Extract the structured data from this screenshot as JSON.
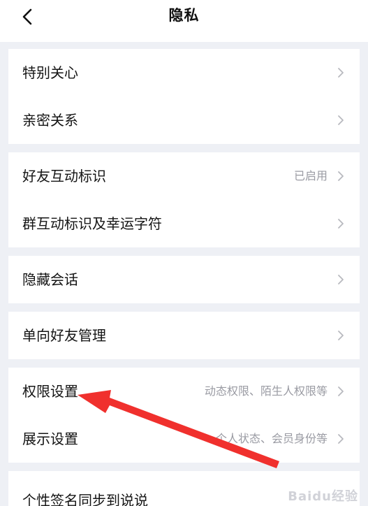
{
  "header": {
    "title": "隐私"
  },
  "rows": [
    {
      "label": "特别关心",
      "value": ""
    },
    {
      "label": "亲密关系",
      "value": ""
    },
    {
      "label": "好友互动标识",
      "value": "已启用"
    },
    {
      "label": "群互动标识及幸运字符",
      "value": ""
    },
    {
      "label": "隐藏会话",
      "value": ""
    },
    {
      "label": "单向好友管理",
      "value": ""
    },
    {
      "label": "权限设置",
      "value": "动态权限、陌生人权限等"
    },
    {
      "label": "展示设置",
      "value": "个人状态、会员身份等"
    },
    {
      "label": "个性签名同步到说说",
      "value": ""
    }
  ],
  "watermark": "Baidu经验",
  "colors": {
    "annotation_arrow": "#f0302d",
    "background": "#eef0f5",
    "chevron": "#b8b9bf"
  },
  "icons": {
    "back": "chevron-left-icon",
    "row": "chevron-right-icon"
  }
}
